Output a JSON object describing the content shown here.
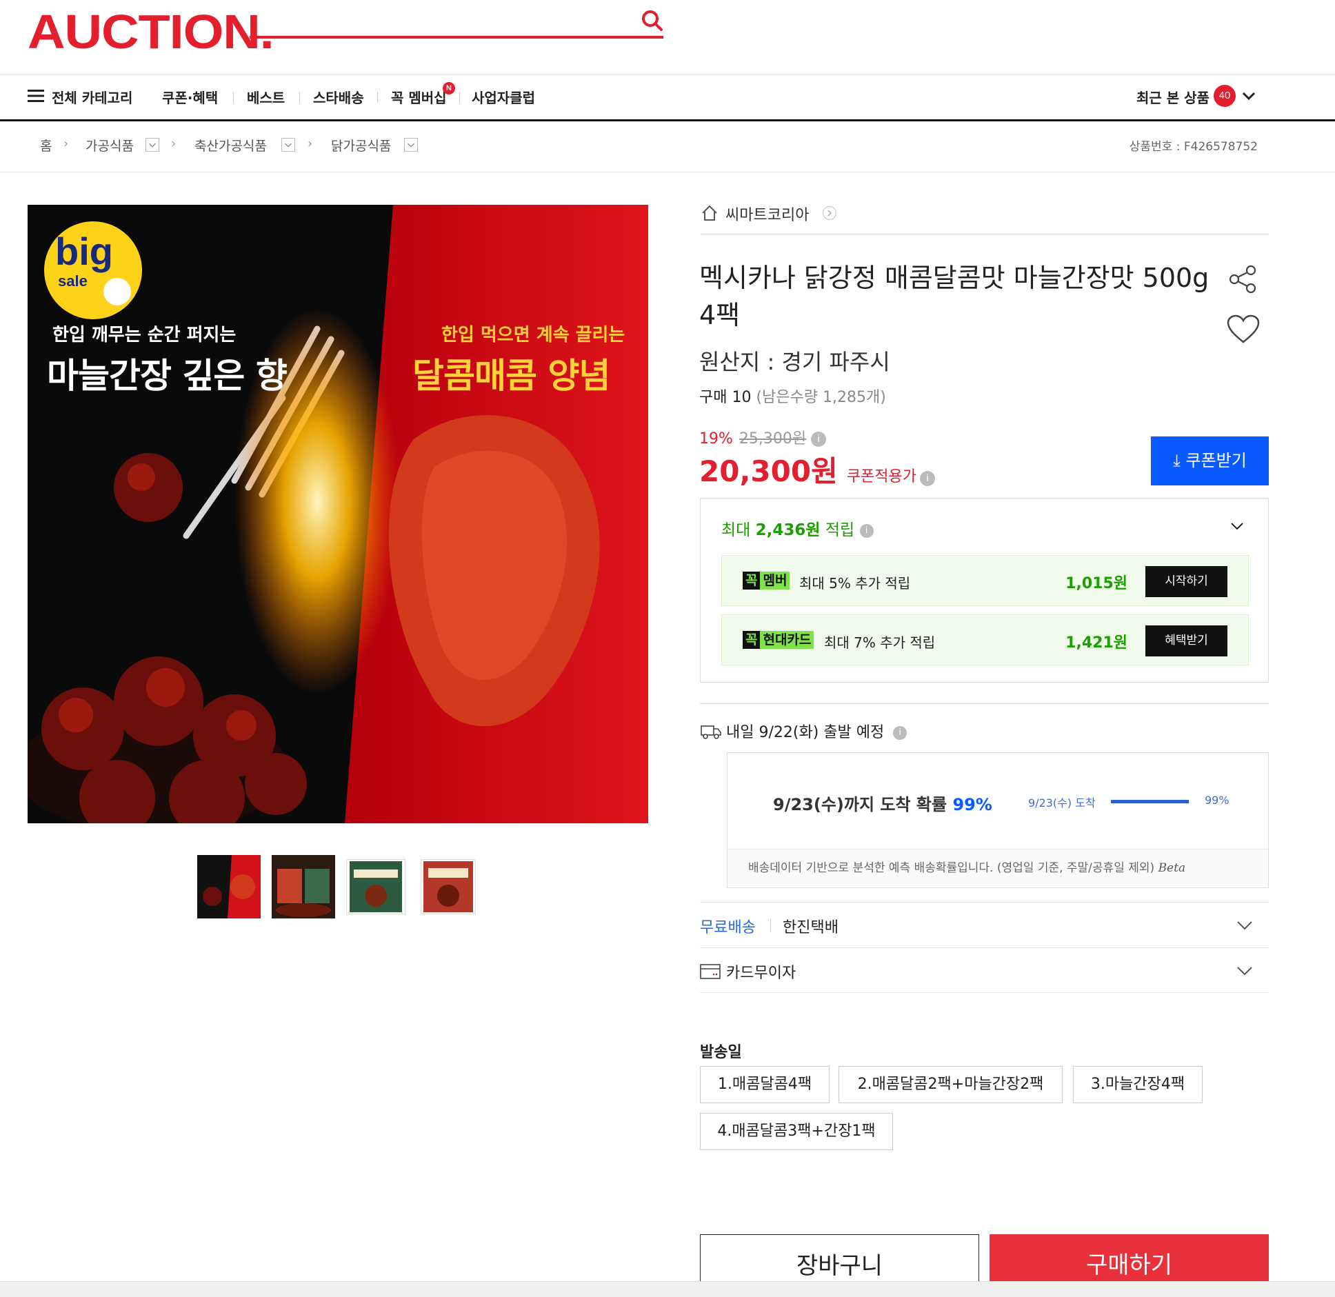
{
  "header": {
    "logo": "AUCTION.",
    "nav": {
      "all_categories": "전체 카테고리",
      "items": [
        "쿠폰·혜택",
        "베스트",
        "스타배송",
        "꼭 멤버십",
        "사업자클럽"
      ],
      "member_badge": "N",
      "recent": "최근 본 상품",
      "recent_count": "40"
    }
  },
  "breadcrumb": {
    "home": "홈",
    "items": [
      "가공식품",
      "축산가공식품",
      "닭가공식품"
    ],
    "product_no": "상품번호 : F426578752"
  },
  "image": {
    "badge_big": "big",
    "badge_sale": "sale",
    "left_sub": "한입 깨무는 순간 퍼지는",
    "left_main": "마늘간장 깊은 향",
    "right_sub": "한입 먹으면 계속 끌리는",
    "right_main": "달콤매콤 양념"
  },
  "product": {
    "seller": "씨마트코리아",
    "title": "멕시카나 닭강정 매콤달콤맛 마늘간장맛 500g 4팩",
    "origin": "원산지 : 경기 파주시",
    "purchase_label": "구매 10",
    "purchase_remaining": "(남은수량 1,285개)",
    "discount_rate": "19%",
    "original_price": "25,300원",
    "price": "20,300원",
    "price_note": "쿠폰적용가",
    "coupon_button": "쿠폰받기"
  },
  "points": {
    "prefix": "최대",
    "amount": "2,436원",
    "suffix": "적립",
    "rows": [
      {
        "tag_k": "꼭",
        "tag_name": "멤버",
        "desc": "최대 5% 추가 적립",
        "amount": "1,015원",
        "button": "시작하기"
      },
      {
        "tag_k": "꼭",
        "tag_name": "현대카드",
        "desc": "최대 7% 추가 적립",
        "amount": "1,421원",
        "button": "혜택받기"
      }
    ]
  },
  "shipping": {
    "departure": "내일 9/22(화) 출발 예정",
    "arrival_text": "9/23(수)까지 도착 확률",
    "arrival_pct": "99%",
    "bar_label": "9/23(수) 도착",
    "bar_pct_label": "99%",
    "bar_value": 0.99,
    "note": "배송데이터 기반으로 분석한 예측 배송확률입니다. (영업일 기준, 주말/공휴일 제외)",
    "beta": "Beta",
    "free_shipping": "무료배송",
    "courier": "한진택배",
    "card": "카드무이자"
  },
  "options": {
    "title": "발송일",
    "items": [
      "1.매콤달콤4팩",
      "2.매콤달콤2팩+마늘간장2팩",
      "3.마늘간장4팩",
      "4.매콤달콤3팩+간장1팩"
    ]
  },
  "actions": {
    "cart": "장바구니",
    "buy": "구매하기"
  },
  "colors": {
    "brand": "#e31e2d",
    "accent_blue": "#0a5bff",
    "green": "#1aa000"
  }
}
